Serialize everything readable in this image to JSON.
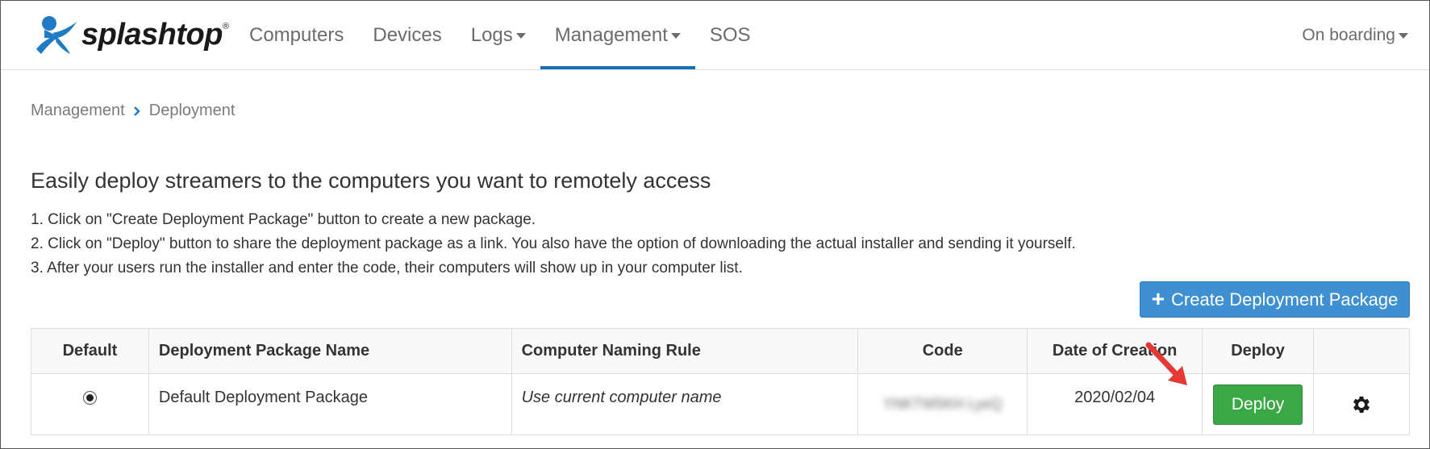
{
  "brand": {
    "name": "splashtop",
    "tm": "®"
  },
  "nav": {
    "items": [
      {
        "label": "Computers",
        "dropdown": false,
        "active": false
      },
      {
        "label": "Devices",
        "dropdown": false,
        "active": false
      },
      {
        "label": "Logs",
        "dropdown": true,
        "active": false
      },
      {
        "label": "Management",
        "dropdown": true,
        "active": true
      },
      {
        "label": "SOS",
        "dropdown": false,
        "active": false
      }
    ],
    "onboarding_label": "On boarding"
  },
  "breadcrumb": {
    "parent": "Management",
    "current": "Deployment"
  },
  "headline": "Easily deploy streamers to the computers you want to remotely access",
  "steps": [
    "1. Click on \"Create Deployment Package\" button to create a new package.",
    "2. Click on \"Deploy\" button to share the deployment package as a link. You also have the option of downloading the actual installer and sending it yourself.",
    "3. After your users run the installer and enter the code, their computers will show up in your computer list."
  ],
  "create_button_label": "Create Deployment Package",
  "table": {
    "headers": {
      "default": "Default",
      "name": "Deployment Package Name",
      "rule": "Computer Naming Rule",
      "code": "Code",
      "date": "Date of Creation",
      "deploy": "Deploy"
    },
    "rows": [
      {
        "name": "Default Deployment Package",
        "rule": "Use current computer name",
        "code": "YNKTW5KH LyeQ",
        "date": "2020/02/04",
        "deploy_label": "Deploy"
      }
    ]
  },
  "colors": {
    "accent": "#1a6fb5",
    "create_button": "#3f8fd3",
    "deploy_button": "#3aa845",
    "annotation_arrow": "#e53935"
  },
  "icons": [
    "splashtop-logo-icon",
    "caret-down-icon",
    "chevron-right-icon",
    "plus-icon",
    "radio-selected-icon",
    "gear-icon",
    "red-arrow-icon"
  ]
}
